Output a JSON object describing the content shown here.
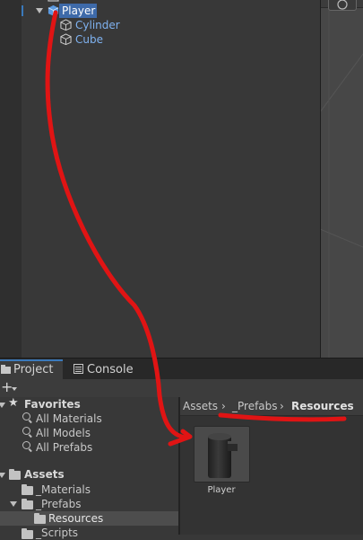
{
  "hierarchy": {
    "items": [
      {
        "label": "Player",
        "selected": true
      },
      {
        "label": "Cylinder"
      },
      {
        "label": "Cube"
      }
    ]
  },
  "project": {
    "tabs": [
      {
        "label": "Project",
        "active": true
      },
      {
        "label": "Console"
      }
    ],
    "add_label": "+",
    "favorites": {
      "label": "Favorites",
      "items": [
        "All Materials",
        "All Models",
        "All Prefabs"
      ]
    },
    "assets": {
      "label": "Assets",
      "items": [
        {
          "label": "_Materials"
        },
        {
          "label": "_Prefabs"
        },
        {
          "label": "Resources",
          "selected": true
        },
        {
          "label": "_Scripts"
        }
      ]
    },
    "breadcrumb": [
      "Assets",
      "_Prefabs",
      "Resources"
    ],
    "asset_items": [
      {
        "label": "Player",
        "icon": "prefab-model-thumbnail"
      }
    ]
  },
  "colors": {
    "selection": "#3e6aa9",
    "annotation": "#e01414",
    "prefab_text": "#7fb2f0"
  }
}
